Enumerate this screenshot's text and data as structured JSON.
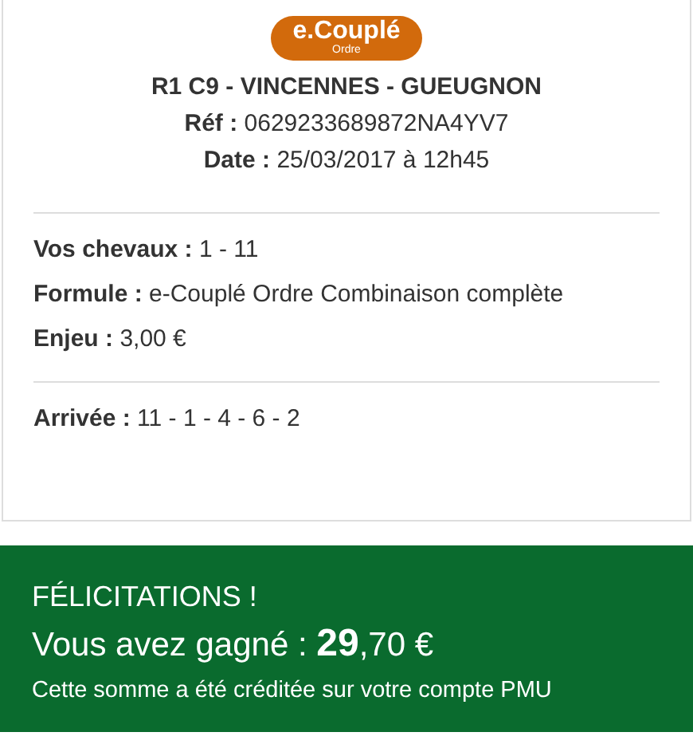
{
  "logo": {
    "main": "e.Couplé",
    "sub": "Ordre"
  },
  "race": {
    "title": "R1 C9 - VINCENNES - GUEUGNON",
    "lines": [
      {
        "label": "Réf :",
        "value": "0629233689872NA4YV7"
      },
      {
        "label": "Date :",
        "value": "25/03/2017 à 12h45"
      }
    ]
  },
  "bet": [
    {
      "label": "Vos chevaux :",
      "value": "1 - 11"
    },
    {
      "label": "Formule :",
      "value": "e-Couplé Ordre Combinaison complète"
    },
    {
      "label": "Enjeu :",
      "value": "3,00 €"
    }
  ],
  "result": {
    "label": "Arrivée :",
    "value": "11 - 1 - 4 - 6 - 2"
  },
  "banner": {
    "title": "FÉLICITATIONS !",
    "amount": "Vous avez gagné : **29**,70 €",
    "note": "Cette somme a été créditée sur votre compte PMU"
  }
}
